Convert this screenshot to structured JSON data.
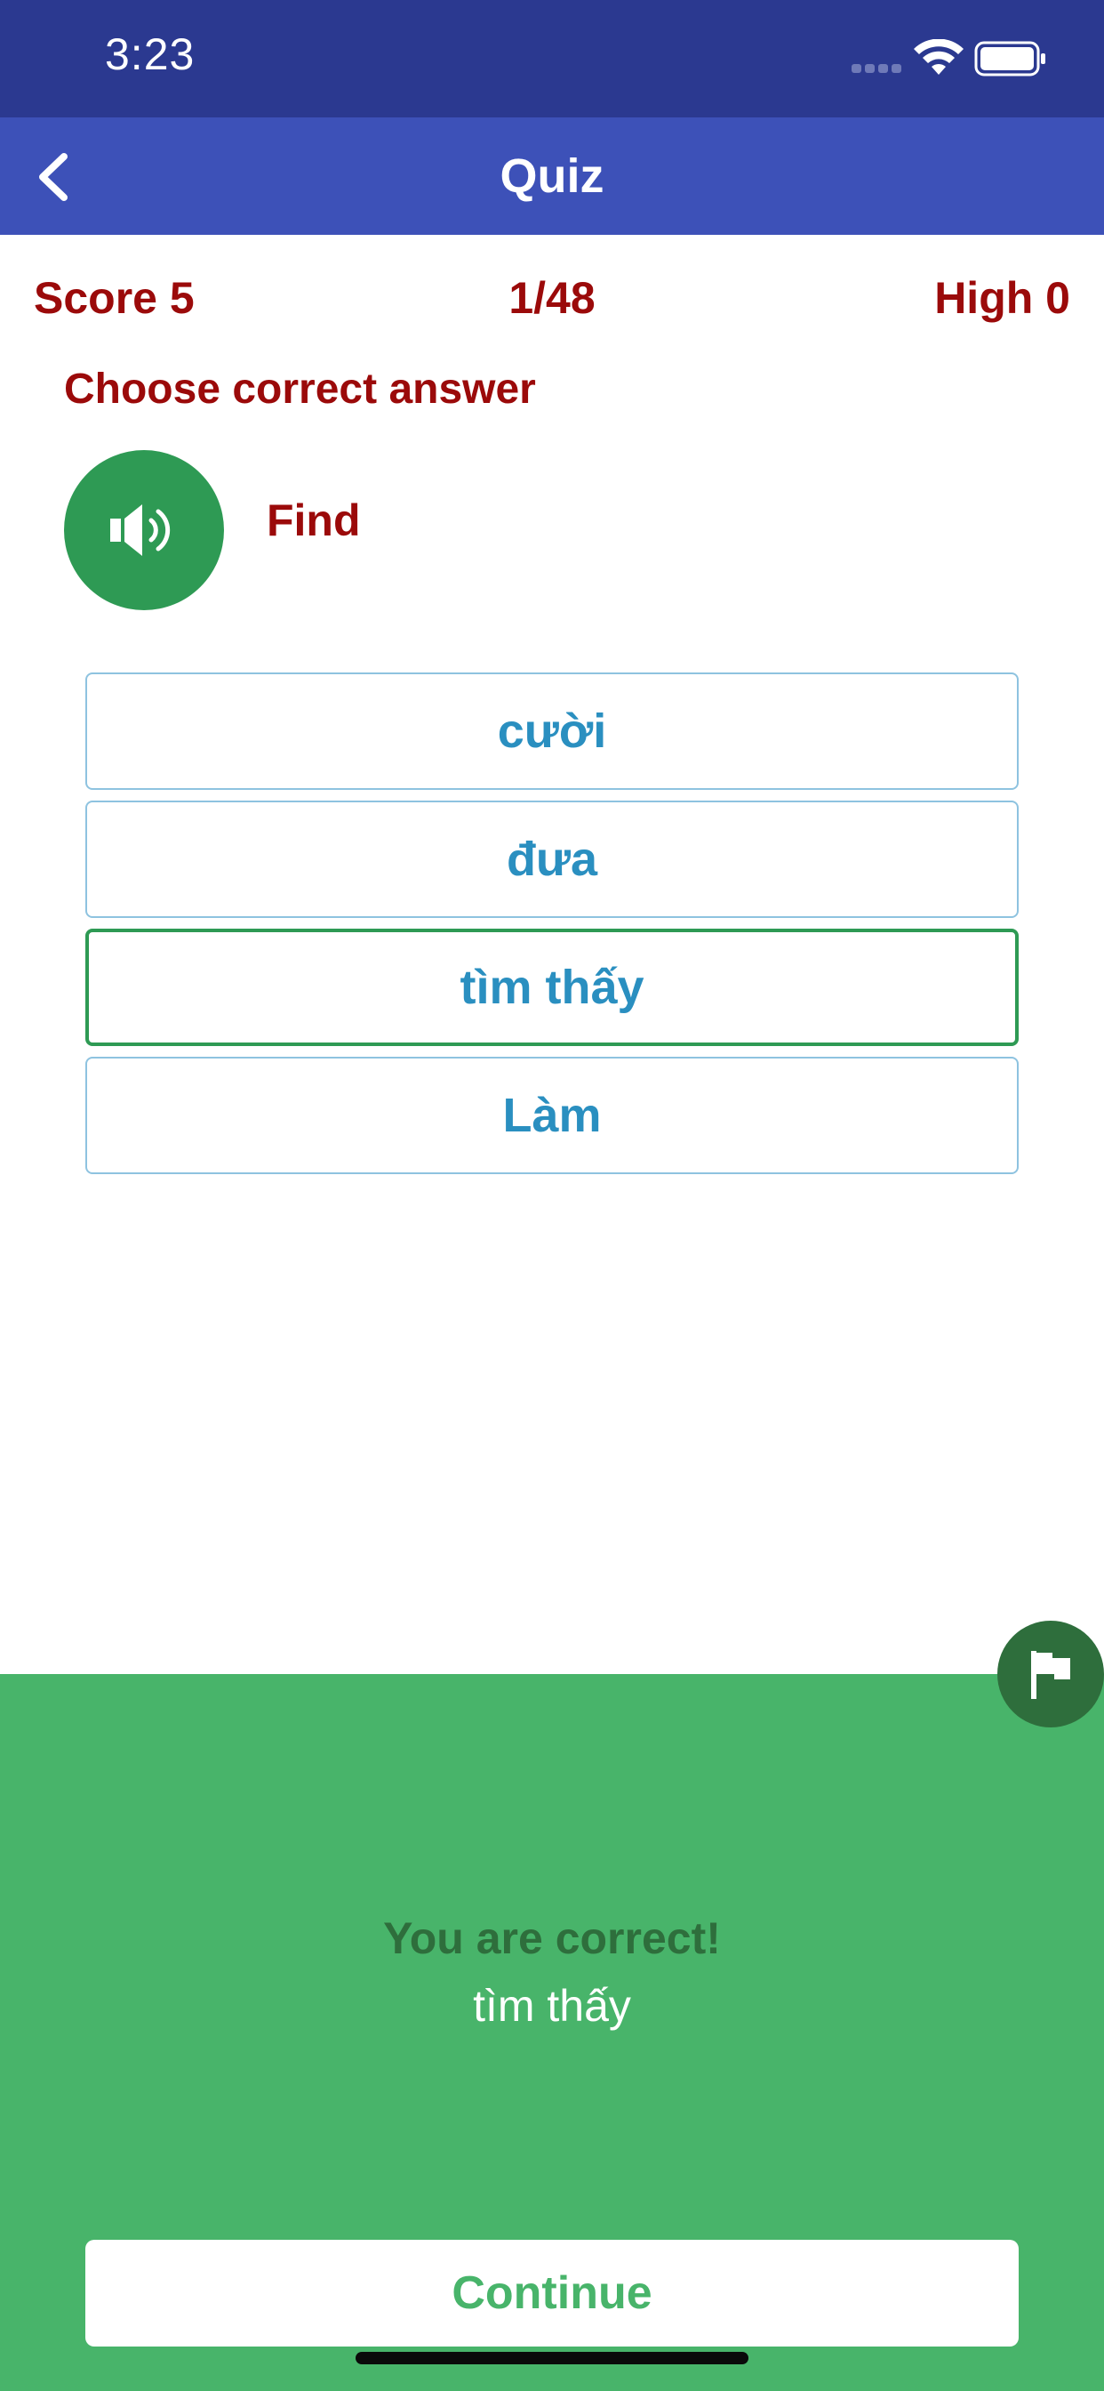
{
  "status_bar": {
    "time": "3:23",
    "icons": [
      "signal-dots-icon",
      "wifi-icon",
      "battery-icon"
    ]
  },
  "nav": {
    "title": "Quiz",
    "back_icon": "chevron-left-icon"
  },
  "quiz": {
    "score_label": "Score  5",
    "progress": "1/48",
    "high_label": "High  0",
    "instruction": "Choose correct answer",
    "word": "Find",
    "speaker_icon": "speaker-icon",
    "options": [
      {
        "label": "cười",
        "selected": false
      },
      {
        "label": "đưa",
        "selected": false
      },
      {
        "label": "tìm thấy",
        "selected": true
      },
      {
        "label": "Làm",
        "selected": false
      }
    ]
  },
  "feedback": {
    "title": "You are correct!",
    "answer": "tìm thấy",
    "continue_label": "Continue",
    "flag_icon": "flag-icon"
  },
  "colors": {
    "status_bar": "#2b3990",
    "nav_bar": "#3d51b8",
    "accent_red": "#9b0a0a",
    "option_text": "#2a8fc0",
    "success_green": "#48b46a",
    "dark_green": "#2e6e3c",
    "speaker_green": "#2e9a54"
  }
}
